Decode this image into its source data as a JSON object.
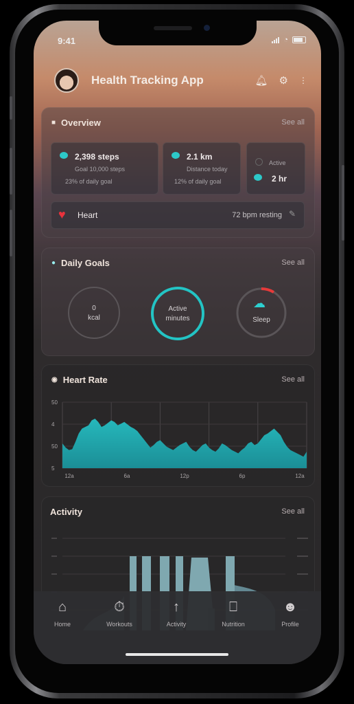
{
  "status": {
    "time": "9:41"
  },
  "header": {
    "title": "Health Tracking App",
    "icons": [
      "bell-icon",
      "settings-icon",
      "more-icon"
    ]
  },
  "overview": {
    "title": "Overview",
    "link": "See all",
    "tiles": [
      {
        "value": "2,398 steps",
        "sub1": "Goal 10,000 steps",
        "sub2": "23% of daily goal"
      },
      {
        "value": "2.1 km",
        "sub1": "Distance today",
        "sub2": "12% of daily goal"
      },
      {
        "value": "2 hr",
        "sub1": "Active"
      }
    ],
    "heart": {
      "label": "Heart",
      "value": "72 bpm resting"
    }
  },
  "goals": {
    "title": "Daily Goals",
    "link": "See all",
    "rings": [
      {
        "line1": "0",
        "line2": "kcal",
        "progress": 0
      },
      {
        "line1": "Active",
        "line2": "minutes",
        "progress": 1
      },
      {
        "line1": "Sleep",
        "progress": 0.08
      }
    ]
  },
  "heart_rate": {
    "title": "Heart Rate",
    "link": "See all",
    "chart_data": {
      "type": "area",
      "y_ticks": [
        "50",
        "4",
        "50",
        "5"
      ],
      "x_ticks": [
        "12a",
        "6a",
        "12p",
        "6p",
        "12a"
      ],
      "values": [
        60,
        55,
        52,
        53,
        62,
        72,
        78,
        80,
        82,
        88,
        90,
        86,
        80,
        82,
        85,
        88,
        86,
        82,
        84,
        86,
        83,
        80,
        78,
        75,
        70,
        65,
        60,
        55,
        58,
        62,
        64,
        60,
        56,
        54,
        52,
        55,
        58,
        60,
        62,
        56,
        52,
        50,
        54,
        58,
        60,
        55,
        52,
        50,
        54,
        60,
        58,
        55,
        52,
        50,
        48,
        52,
        55,
        60,
        62,
        58,
        60,
        65,
        70,
        72,
        75,
        78,
        74,
        70,
        62,
        56,
        52,
        50,
        48,
        46,
        44,
        50
      ]
    }
  },
  "activity": {
    "title": "Activity",
    "link": "See all",
    "chart_data": {
      "type": "bar",
      "left_ticks": [
        "",
        "",
        "",
        "",
        ""
      ],
      "right_ticks": [
        "",
        "",
        "",
        "",
        ""
      ]
    }
  },
  "nav": [
    {
      "label": "Home",
      "icon": "home-icon"
    },
    {
      "label": "Workouts",
      "icon": "stopwatch-icon"
    },
    {
      "label": "Activity",
      "icon": "activity-icon"
    },
    {
      "label": "Nutrition",
      "icon": "cup-icon"
    },
    {
      "label": "Profile",
      "icon": "profile-icon"
    }
  ],
  "colors": {
    "accent": "#2dc8c8",
    "heart": "#e8323c",
    "ring_red": "#e63a3a"
  }
}
